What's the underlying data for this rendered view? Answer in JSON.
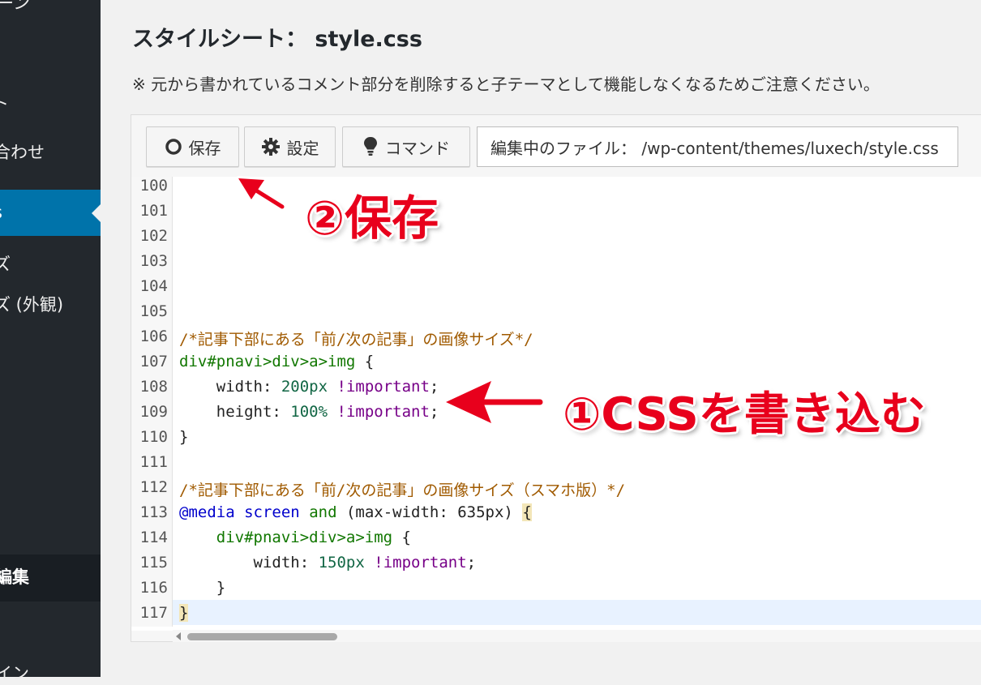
{
  "sidebar": {
    "items": [
      {
        "label": "ーン"
      },
      {
        "label": "ト"
      },
      {
        "label": "合わせ"
      },
      {
        "label": "s"
      },
      {
        "label": "ズ"
      },
      {
        "label": "ズ (外観)"
      },
      {
        "label": "編集"
      },
      {
        "label": "イン"
      }
    ]
  },
  "page": {
    "title": "スタイルシート： style.css",
    "notice": "※ 元から書かれているコメント部分を削除すると子テーマとして機能しなくなるためご注意ください。"
  },
  "toolbar": {
    "save_label": "保存",
    "settings_label": "設定",
    "command_label": "コマンド",
    "file_path": "編集中のファイル： /wp-content/themes/luxech/style.css"
  },
  "editor": {
    "line_numbers": [
      "100",
      "101",
      "102",
      "103",
      "104",
      "105",
      "106",
      "107",
      "108",
      "109",
      "110",
      "111",
      "112",
      "113",
      "114",
      "115",
      "116",
      "117"
    ],
    "comment1": "/*記事下部にある「前/次の記事」の画像サイズ*/",
    "selector": "div#pnavi>div>a>img",
    "brace_open": " {",
    "prop_width": "width",
    "prop_height": "height",
    "value_width": "200px",
    "value_height": "100%",
    "important": "!important",
    "brace_close": "}",
    "comment2": "/*記事下部にある「前/次の記事」の画像サイズ（スマホ版）*/",
    "at_media": "@media",
    "media_screen": "screen",
    "media_and": "and",
    "media_cond": "(max-width: 635px)",
    "value_width_sp": "150px"
  },
  "annotations": {
    "save_note": "②保存",
    "css_note": "①CSSを書き込む",
    "color": "#e8001c"
  },
  "colors": {
    "sidebar_bg": "#23282d",
    "sidebar_active": "#0073aa",
    "page_bg": "#f1f1f1"
  }
}
